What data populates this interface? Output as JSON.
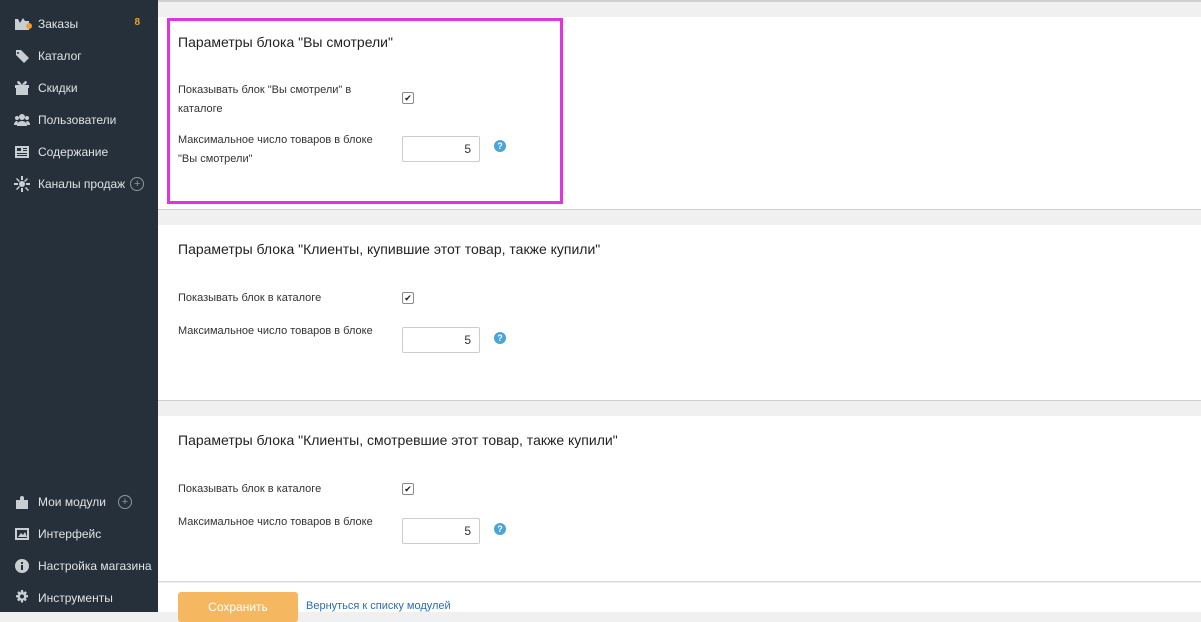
{
  "sidebar": {
    "items": [
      {
        "label": "Заказы",
        "icon": "orders-icon",
        "badge": "8"
      },
      {
        "label": "Каталог",
        "icon": "tag-icon"
      },
      {
        "label": "Скидки",
        "icon": "gift-icon"
      },
      {
        "label": "Пользователи",
        "icon": "users-icon"
      },
      {
        "label": "Содержание",
        "icon": "content-icon"
      },
      {
        "label": "Каналы продаж",
        "icon": "sales-channels-icon",
        "plus": "+"
      }
    ],
    "bottom_items": [
      {
        "label": "Мои модули",
        "icon": "puzzle-icon",
        "plus": "+"
      },
      {
        "label": "Интерфейс",
        "icon": "image-icon"
      },
      {
        "label": "Настройка магазина",
        "icon": "info-icon"
      },
      {
        "label": "Инструменты",
        "icon": "gear-icon"
      }
    ]
  },
  "blocks": [
    {
      "title": "Параметры блока \"Вы смотрели\"",
      "show_label": "Показывать блок \"Вы смотрели\" в каталоге",
      "show_checked": true,
      "max_label": "Максимальное число товаров в блоке \"Вы смотрели\"",
      "max_value": "5"
    },
    {
      "title": "Параметры блока \"Клиенты, купившие этот товар, также купили\"",
      "show_label": "Показывать блок в каталоге",
      "show_checked": true,
      "max_label": "Максимальное число товаров в блоке",
      "max_value": "5"
    },
    {
      "title": "Параметры блока \"Клиенты, смотревшие этот товар, также купили\"",
      "show_label": "Показывать блок в каталоге",
      "show_checked": true,
      "max_label": "Максимальное число товаров в блоке",
      "max_value": "5"
    }
  ],
  "help_glyph": "?",
  "check_glyph": "✔",
  "footer": {
    "save_label": "Сохранить",
    "back_link": "Вернуться к списку модулей"
  },
  "colors": {
    "sidebar_bg": "#26303a",
    "highlight": "#e233e2",
    "accent": "#f5b860",
    "badge": "#f0a030",
    "help": "#4ba3d9"
  }
}
